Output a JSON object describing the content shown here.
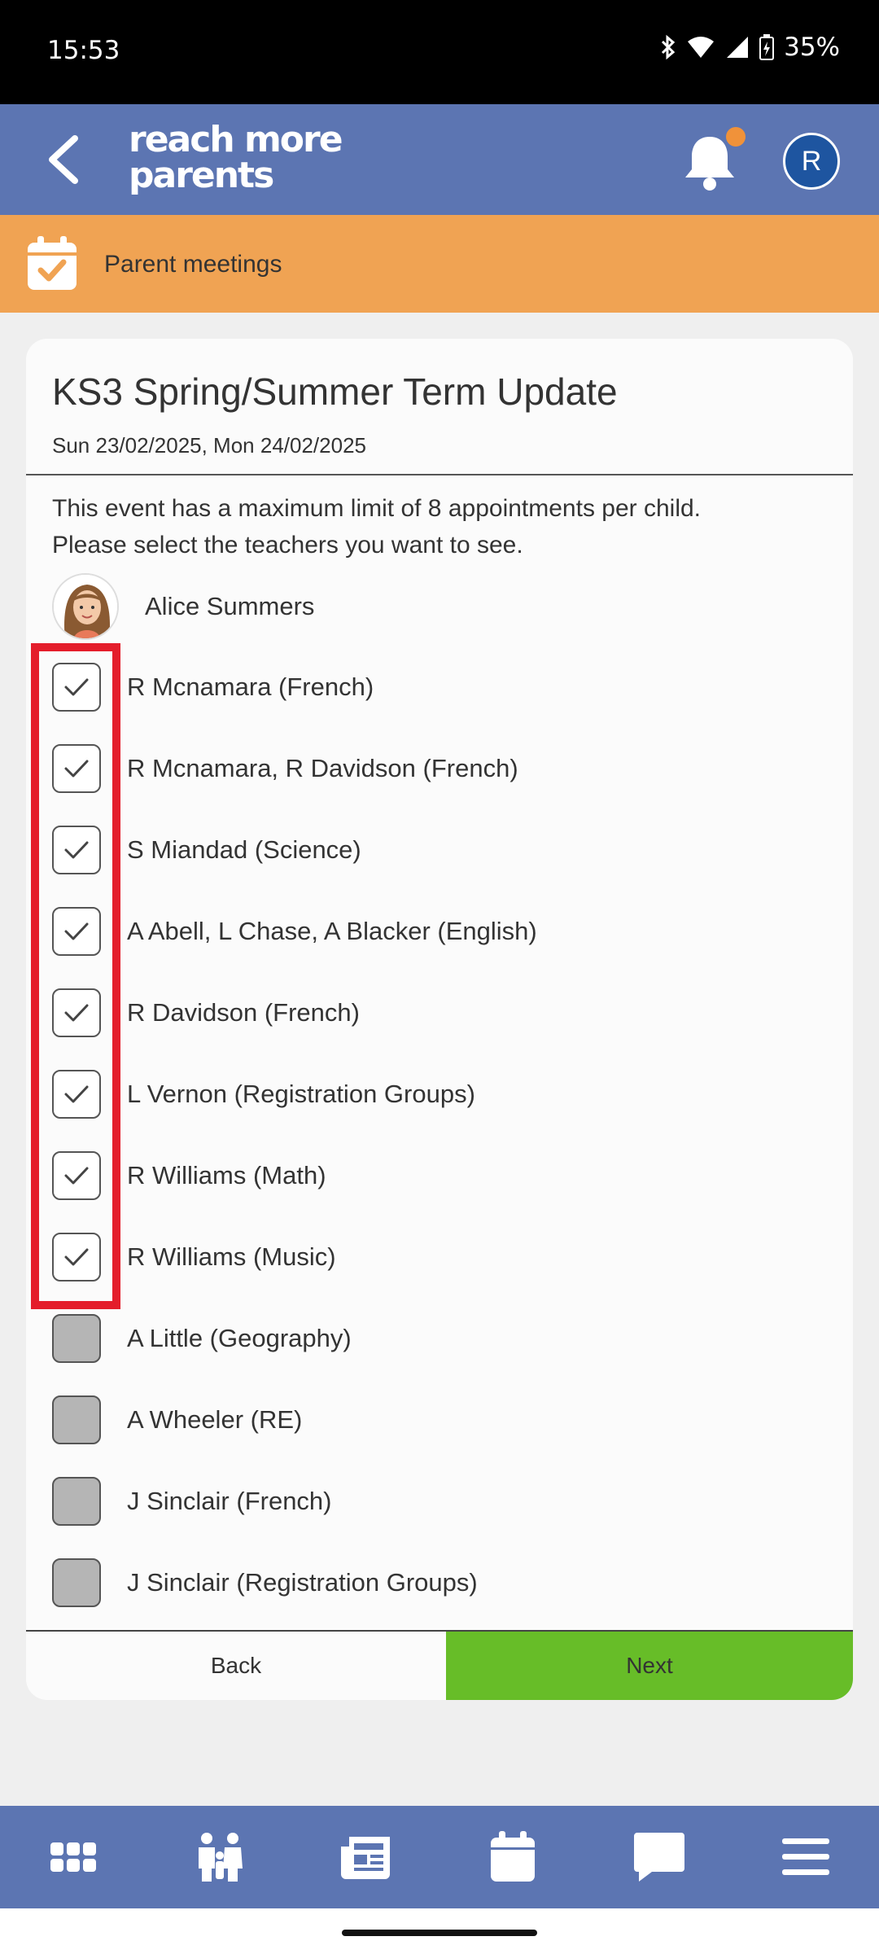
{
  "status_bar": {
    "time": "15:53",
    "battery": "35%"
  },
  "header": {
    "logo_line1": "reach more",
    "logo_line2": "parents",
    "avatar_initial": "R"
  },
  "section": {
    "title": "Parent meetings"
  },
  "event": {
    "title": "KS3 Spring/Summer Term Update",
    "dates": "Sun 23/02/2025, Mon 24/02/2025",
    "info_line1": "This event has a maximum limit of 8 appointments per child.",
    "info_line2": "Please select the teachers you want to see."
  },
  "child": {
    "name": "Alice Summers"
  },
  "teachers": [
    {
      "label": "R Mcnamara (French)",
      "checked": true
    },
    {
      "label": "R Mcnamara, R Davidson (French)",
      "checked": true
    },
    {
      "label": "S Miandad (Science)",
      "checked": true
    },
    {
      "label": "A Abell, L Chase, A Blacker (English)",
      "checked": true
    },
    {
      "label": "R Davidson (French)",
      "checked": true
    },
    {
      "label": "L Vernon (Registration Groups)",
      "checked": true
    },
    {
      "label": "R Williams (Math)",
      "checked": true
    },
    {
      "label": "R Williams (Music)",
      "checked": true
    },
    {
      "label": "A Little (Geography)",
      "checked": false
    },
    {
      "label": "A Wheeler (RE)",
      "checked": false
    },
    {
      "label": "J Sinclair (French)",
      "checked": false
    },
    {
      "label": "J Sinclair (Registration Groups)",
      "checked": false
    }
  ],
  "buttons": {
    "back": "Back",
    "next": "Next"
  },
  "bottom_nav": [
    {
      "icon": "apps-grid-icon"
    },
    {
      "icon": "family-icon"
    },
    {
      "icon": "newspaper-icon"
    },
    {
      "icon": "calendar-icon"
    },
    {
      "icon": "chat-bubble-icon"
    },
    {
      "icon": "hamburger-menu-icon"
    }
  ],
  "colors": {
    "header": "#5c75b2",
    "section_bar": "#f0a353",
    "next_button": "#67bd28",
    "highlight": "#e41d2b"
  }
}
